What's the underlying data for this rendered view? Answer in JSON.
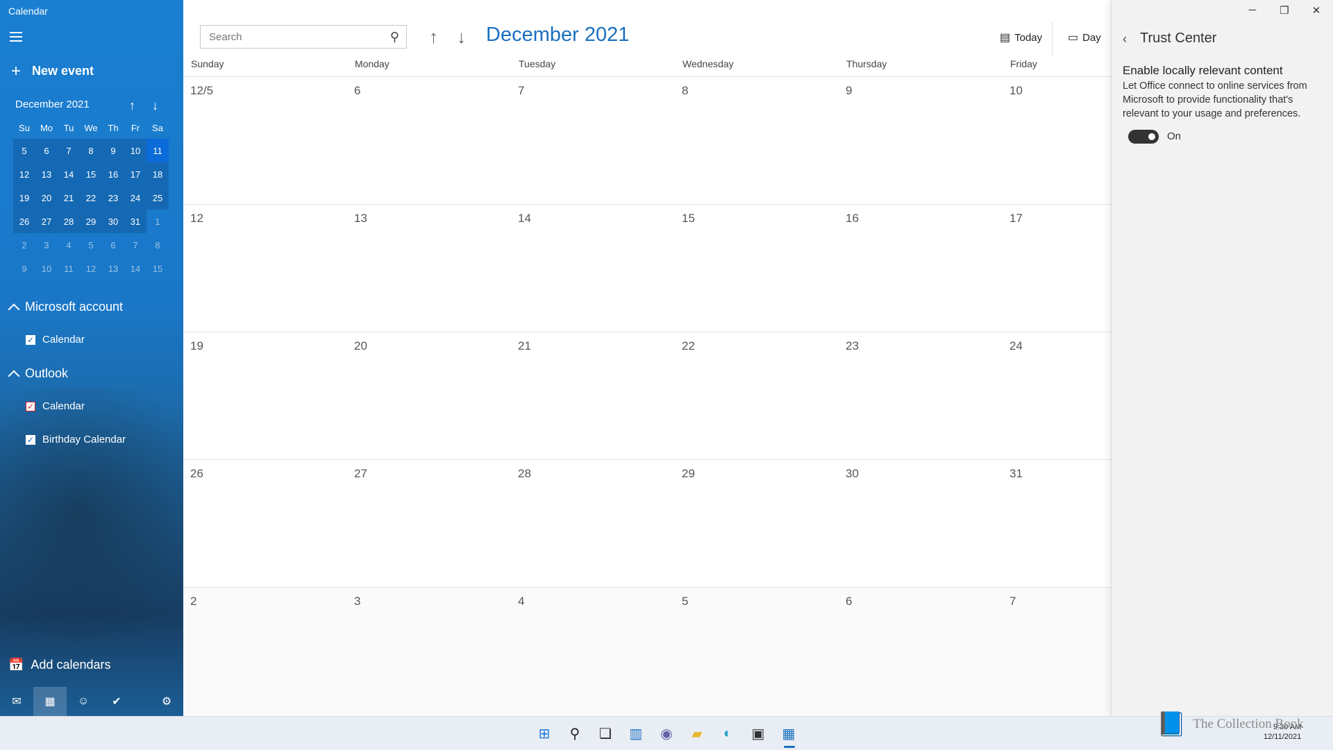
{
  "app": {
    "title": "Calendar"
  },
  "sidebar": {
    "new_event_label": "New event",
    "mini_calendar": {
      "title": "December 2021",
      "weekdays": [
        "Su",
        "Mo",
        "Tu",
        "We",
        "Th",
        "Fr",
        "Sa"
      ],
      "weeks": [
        [
          "5",
          "6",
          "7",
          "8",
          "9",
          "10",
          "11"
        ],
        [
          "12",
          "13",
          "14",
          "15",
          "16",
          "17",
          "18"
        ],
        [
          "19",
          "20",
          "21",
          "22",
          "23",
          "24",
          "25"
        ],
        [
          "26",
          "27",
          "28",
          "29",
          "30",
          "31",
          "1"
        ],
        [
          "2",
          "3",
          "4",
          "5",
          "6",
          "7",
          "8"
        ],
        [
          "9",
          "10",
          "11",
          "12",
          "13",
          "14",
          "15"
        ]
      ],
      "today": "11"
    },
    "accounts": [
      {
        "name": "Microsoft account",
        "calendars": [
          {
            "label": "Calendar",
            "color": "#ffffff"
          }
        ]
      },
      {
        "name": "Outlook",
        "calendars": [
          {
            "label": "Calendar",
            "color": "#d3202b"
          },
          {
            "label": "Birthday Calendar",
            "color": "#ffffff"
          }
        ]
      }
    ],
    "add_calendars_label": "Add calendars",
    "bottom_icons": [
      "mail-icon",
      "calendar-icon",
      "people-icon",
      "todo-icon",
      "settings-icon"
    ]
  },
  "toolbar": {
    "search_placeholder": "Search",
    "month_title": "December 2021",
    "today_label": "Today",
    "day_label": "Day"
  },
  "month_view": {
    "weekdays": [
      "Sunday",
      "Monday",
      "Tuesday",
      "Wednesday",
      "Thursday",
      "Friday"
    ],
    "weeks": [
      [
        "12/5",
        "6",
        "7",
        "8",
        "9",
        "10"
      ],
      [
        "12",
        "13",
        "14",
        "15",
        "16",
        "17"
      ],
      [
        "19",
        "20",
        "21",
        "22",
        "23",
        "24"
      ],
      [
        "26",
        "27",
        "28",
        "29",
        "30",
        "31"
      ],
      [
        "2",
        "3",
        "4",
        "5",
        "6",
        "7"
      ]
    ]
  },
  "trust_center": {
    "title": "Trust Center",
    "heading": "Enable locally relevant content",
    "description": "Let Office connect to online services from Microsoft to provide functionality that's relevant to your usage and preferences.",
    "toggle_label": "On",
    "toggle_on": true
  },
  "taskbar": {
    "time": "9:30 AM",
    "date": "12/11/2021",
    "watermark": "The Collection Book"
  },
  "colors": {
    "accent": "#1a6fbf",
    "sidebar": "#1a77c8"
  }
}
